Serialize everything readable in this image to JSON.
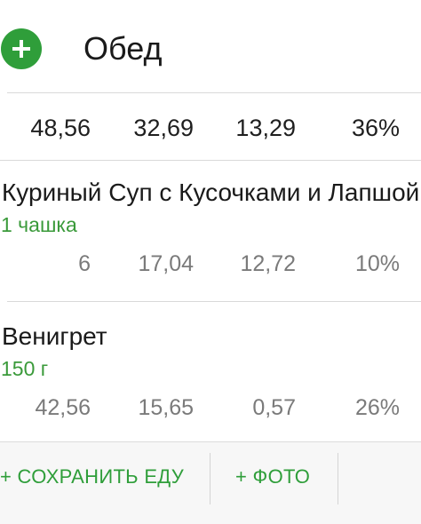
{
  "meal": {
    "title": "Обед",
    "add_icon": "plus-icon"
  },
  "totals": [
    "48,56",
    "32,69",
    "13,29",
    "36%"
  ],
  "foods": [
    {
      "name": "Куриный Суп с Кусочками и Лапшой",
      "serving": "1 чашка",
      "values": [
        "6",
        "17,04",
        "12,72",
        "10%"
      ]
    },
    {
      "name": "Венигрет",
      "serving": "150 г",
      "values": [
        "42,56",
        "15,65",
        "0,57",
        "26%"
      ]
    }
  ],
  "actions": {
    "save_label": "+ СОХРАНИТЬ ЕДУ",
    "photo_label": "+ ФОТО"
  },
  "colors": {
    "accent": "#2f9e3a",
    "text": "#1a1a1a",
    "secondary_text": "#7a7a7a"
  }
}
